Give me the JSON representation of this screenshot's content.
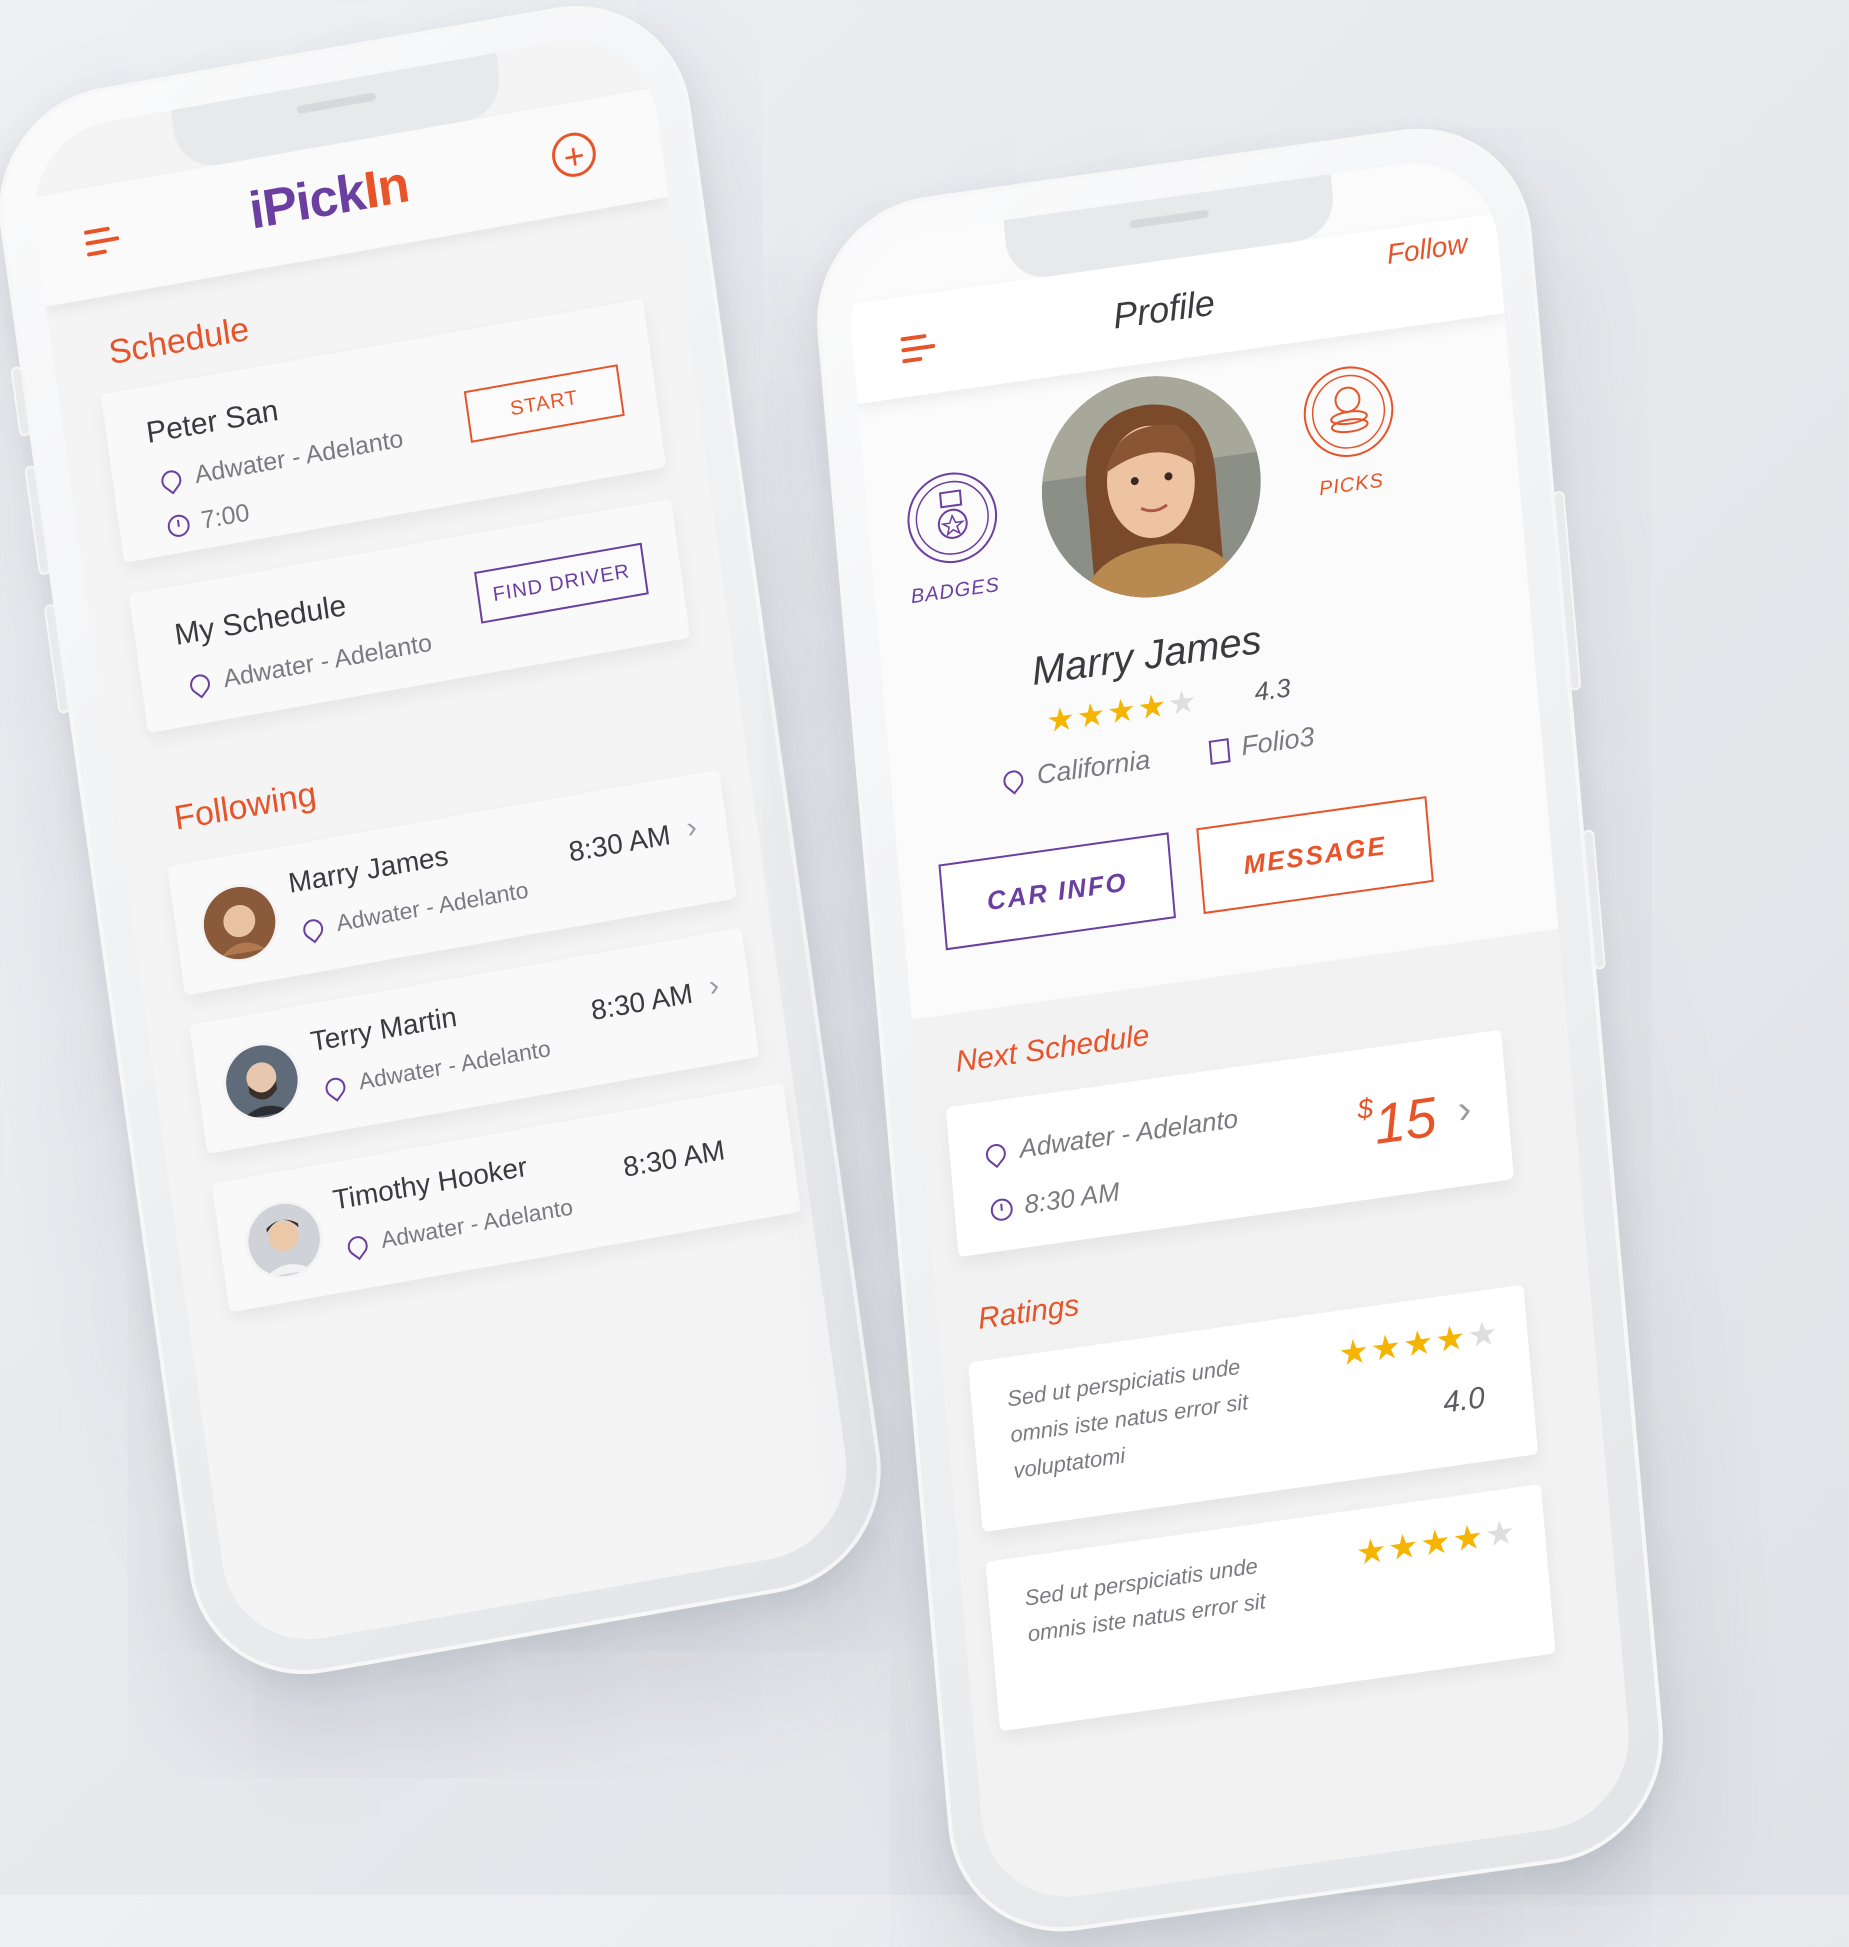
{
  "colors": {
    "accent": "#e8542a",
    "brand_purple": "#6a3fa0",
    "star": "#f5b400"
  },
  "left_phone": {
    "logo": {
      "part1": "iPick",
      "part2": "In"
    },
    "schedule_title": "Schedule",
    "schedule_cards": [
      {
        "name": "Peter San",
        "route": "Adwater - Adelanto",
        "time": "7:00",
        "button": "START"
      },
      {
        "name": "My Schedule",
        "route": "Adwater - Adelanto",
        "button": "FIND DRIVER"
      }
    ],
    "following_title": "Following",
    "following": [
      {
        "name": "Marry James",
        "route": "Adwater - Adelanto",
        "time": "8:30 AM"
      },
      {
        "name": "Terry Martin",
        "route": "Adwater - Adelanto",
        "time": "8:30 AM"
      },
      {
        "name": "Timothy Hooker",
        "route": "Adwater - Adelanto",
        "time": "8:30 AM"
      }
    ]
  },
  "right_phone": {
    "title": "Profile",
    "follow": "Follow",
    "badges_label": "BADGES",
    "picks_label": "PICKS",
    "name": "Marry James",
    "rating": {
      "value": "4.3",
      "stars": 4,
      "max": 5
    },
    "location": "California",
    "company": "Folio3",
    "car_info": "CAR INFO",
    "message": "MESSAGE",
    "next_schedule_title": "Next Schedule",
    "next_schedule": {
      "route": "Adwater - Adelanto",
      "time": "8:30 AM",
      "currency": "$",
      "price": "15"
    },
    "ratings_title": "Ratings",
    "ratings": [
      {
        "text": "Sed ut perspiciatis unde omnis iste natus error sit voluptatomi",
        "value": "4.0",
        "stars": 4
      },
      {
        "text": "Sed ut perspiciatis unde omnis iste natus error sit",
        "value": "",
        "stars": 4
      }
    ]
  }
}
